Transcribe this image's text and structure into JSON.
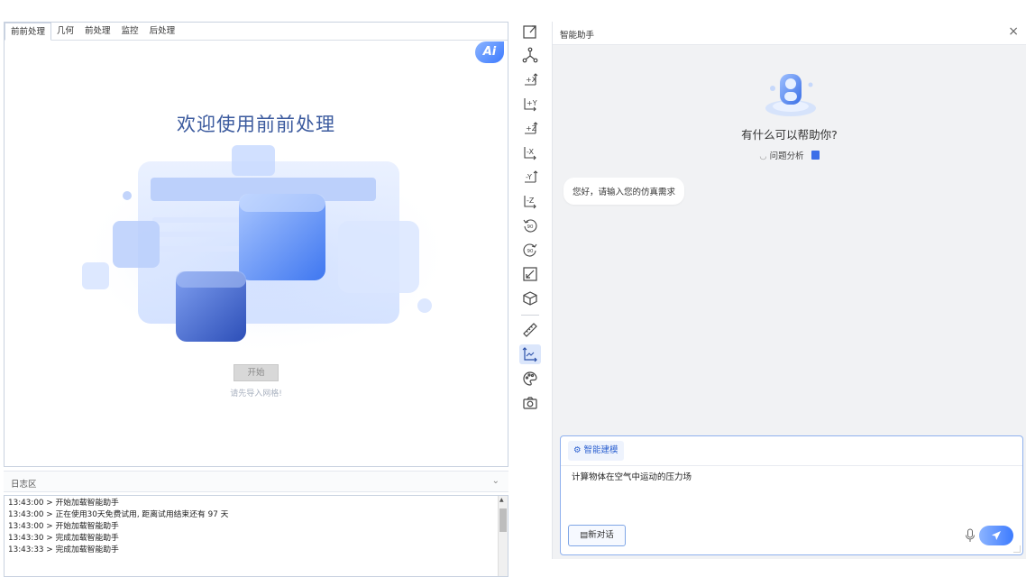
{
  "tabs": [
    {
      "label": "前前处理",
      "active": true
    },
    {
      "label": "几何",
      "active": false
    },
    {
      "label": "前处理",
      "active": false
    },
    {
      "label": "监控",
      "active": false
    },
    {
      "label": "后处理",
      "active": false
    }
  ],
  "ai_badge": "Ai",
  "welcome": {
    "title": "欢迎使用前前处理",
    "start_label": "开始",
    "hint": "请先导入网格!"
  },
  "log": {
    "title": "日志区",
    "lines": [
      "13:43:00 > 开始加载智能助手",
      "13:43:00 > 正在使用30天免费试用, 距离试用结束还有 97 天",
      "13:43:00 > 开始加载智能助手",
      "13:43:30 > 完成加载智能助手",
      "13:43:33 > 完成加载智能助手"
    ]
  },
  "toolbar": {
    "icons": [
      "fit-view-icon",
      "axis-tree-icon",
      "view-plus-x-icon",
      "view-plus-y-icon",
      "view-plus-z-icon",
      "view-minus-x-icon",
      "view-minus-y-icon",
      "view-minus-z-icon",
      "rotate-ccw-90-icon",
      "rotate-cw-90-icon",
      "zoom-box-icon",
      "isometric-cube-icon",
      "ruler-icon",
      "chart-axis-icon",
      "palette-icon",
      "camera-icon"
    ],
    "active": "chart-axis-icon"
  },
  "assistant": {
    "title": "智能助手",
    "help_title": "有什么可以帮助你?",
    "analysis_label": "问题分析",
    "greeting": "您好，请输入您的仿真需求",
    "mode_label": "智能建模",
    "input_value": "计算物体在空气中运动的压力场",
    "new_chat_label": "新对话"
  },
  "colors": {
    "accent": "#3d7bff",
    "title_blue": "#3b5a9e",
    "panel_bg": "#f1f2f4"
  }
}
